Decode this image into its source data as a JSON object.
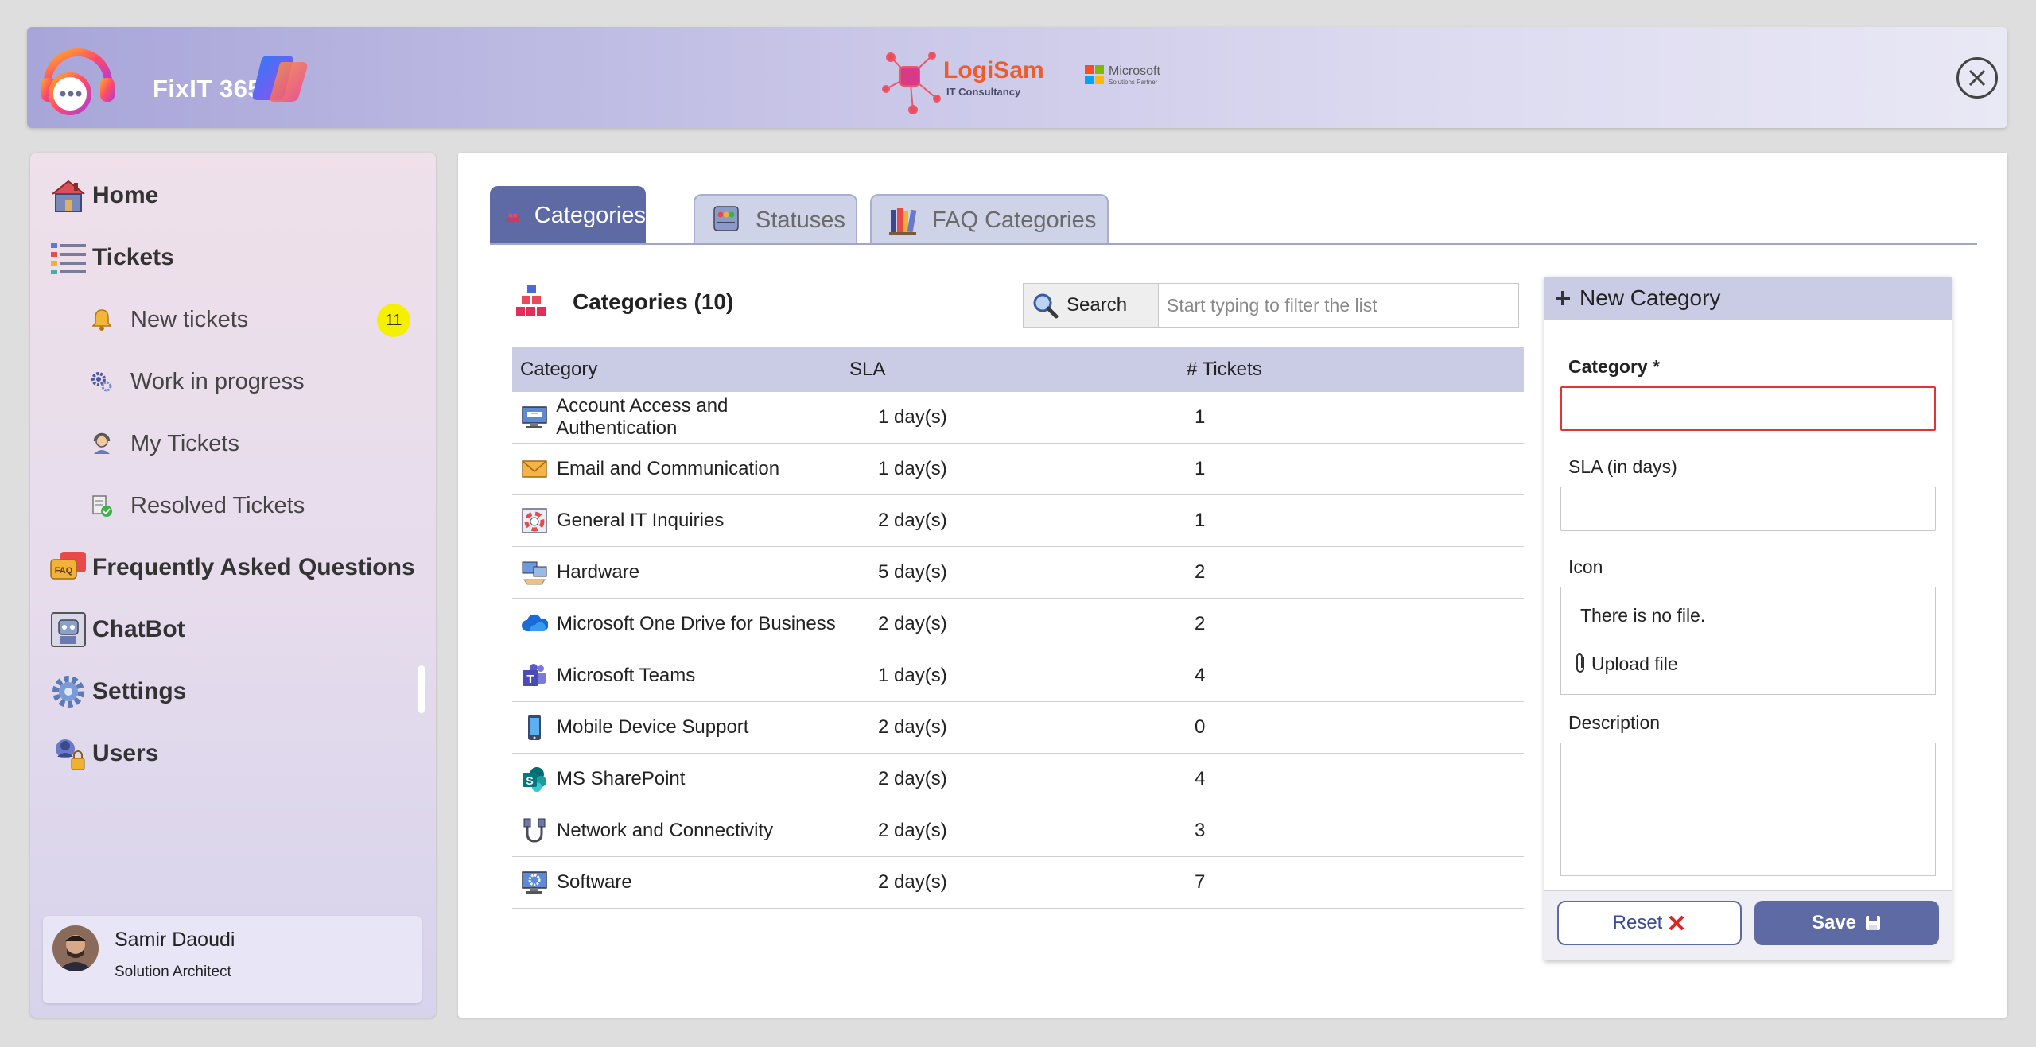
{
  "header": {
    "app_title": "FixIT 365",
    "partner_name": "LogiSam",
    "partner_sub": "IT Consultancy",
    "ms_line1": "Microsoft",
    "ms_line2": "Solutions Partner"
  },
  "sidebar": {
    "home": "Home",
    "tickets": "Tickets",
    "new_tickets": "New tickets",
    "new_tickets_count": "11",
    "work_in_progress": "Work in progress",
    "my_tickets": "My Tickets",
    "resolved_tickets": "Resolved Tickets",
    "faq": "Frequently Asked Questions",
    "chatbot": "ChatBot",
    "settings": "Settings",
    "users": "Users",
    "user": {
      "name": "Samir Daoudi",
      "role": "Solution Architect"
    }
  },
  "tabs": {
    "categories": "Categories",
    "statuses": "Statuses",
    "faq_categories": "FAQ Categories"
  },
  "list": {
    "title": "Categories (10)",
    "search_label": "Search",
    "search_placeholder": "Start typing to filter the list",
    "columns": {
      "category": "Category",
      "sla": "SLA",
      "tickets": "# Tickets"
    },
    "rows": [
      {
        "icon": "login-monitor-icon",
        "category": "Account Access and Authentication",
        "sla": "1 day(s)",
        "tickets": "1"
      },
      {
        "icon": "envelope-icon",
        "category": "Email and Communication",
        "sla": "1 day(s)",
        "tickets": "1"
      },
      {
        "icon": "lifebuoy-icon",
        "category": "General IT Inquiries",
        "sla": "2 day(s)",
        "tickets": "1"
      },
      {
        "icon": "hardware-icon",
        "category": "Hardware",
        "sla": "5 day(s)",
        "tickets": "2"
      },
      {
        "icon": "onedrive-cloud-icon",
        "category": "Microsoft One Drive for Business",
        "sla": "2 day(s)",
        "tickets": "2"
      },
      {
        "icon": "teams-icon",
        "category": "Microsoft Teams",
        "sla": "1 day(s)",
        "tickets": "4"
      },
      {
        "icon": "mobile-phone-icon",
        "category": "Mobile Device Support",
        "sla": "2 day(s)",
        "tickets": "0"
      },
      {
        "icon": "sharepoint-icon",
        "category": "MS SharePoint",
        "sla": "2 day(s)",
        "tickets": "4"
      },
      {
        "icon": "network-cable-icon",
        "category": "Network and Connectivity",
        "sla": "2 day(s)",
        "tickets": "3"
      },
      {
        "icon": "software-gear-icon",
        "category": "Software",
        "sla": "2 day(s)",
        "tickets": "7"
      }
    ]
  },
  "form": {
    "title": "New Category",
    "category_label": "Category *",
    "sla_label": "SLA (in days)",
    "icon_label": "Icon",
    "no_file": "There is no file.",
    "upload_file": "Upload file",
    "description_label": "Description",
    "reset": "Reset",
    "save": "Save"
  },
  "colors": {
    "accent": "#5e6aa4",
    "tab_inactive": "#cfd3e8",
    "table_header": "#c9cce4",
    "badge": "#f5f000",
    "error_border": "#e33434"
  }
}
